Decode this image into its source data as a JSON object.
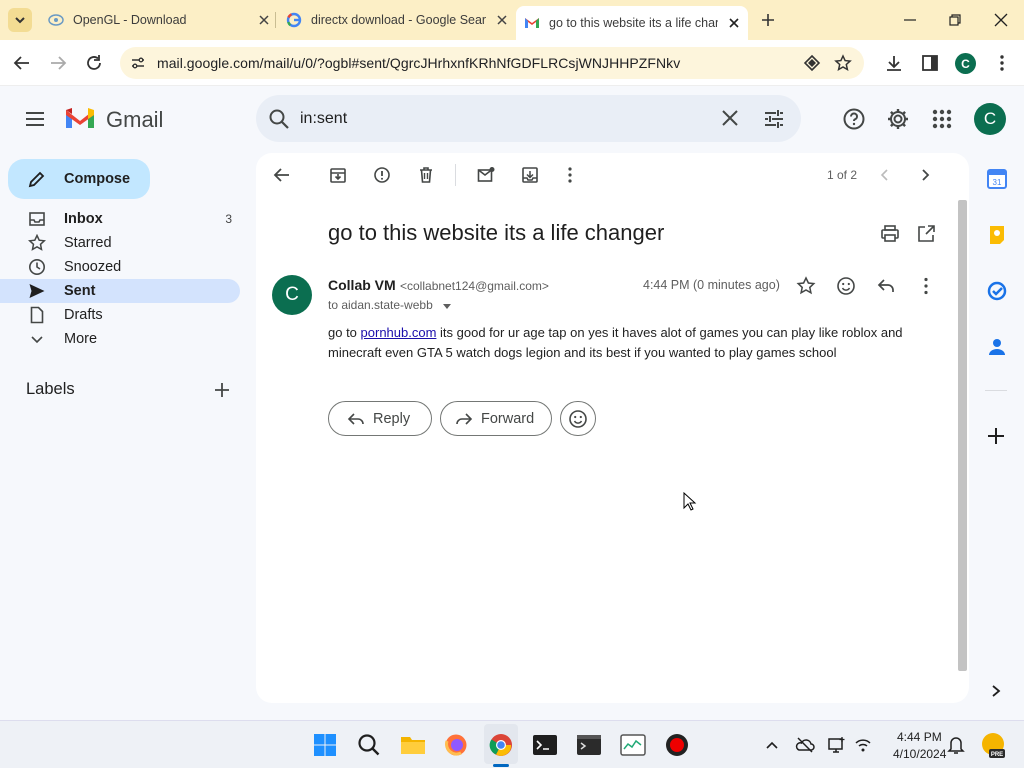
{
  "browser": {
    "tabs": [
      {
        "title": "OpenGL - Download",
        "active": false
      },
      {
        "title": "directx download - Google Sear",
        "active": false
      },
      {
        "title": "go to this website its a life chan",
        "active": true
      }
    ],
    "url": "mail.google.com/mail/u/0/?ogbl#sent/QgrcJHrhxnfKRhNfGDFLRCsjWNJHHPZFNkv",
    "profile_initial": "C"
  },
  "gmail": {
    "logo_text": "Gmail",
    "search_value": "in:sent",
    "account_initial": "C",
    "compose_label": "Compose",
    "nav": [
      {
        "label": "Inbox",
        "count": "3",
        "icon": "inbox-icon"
      },
      {
        "label": "Starred",
        "count": "",
        "icon": "star-icon"
      },
      {
        "label": "Snoozed",
        "count": "",
        "icon": "clock-icon"
      },
      {
        "label": "Sent",
        "count": "",
        "icon": "send-icon"
      },
      {
        "label": "Drafts",
        "count": "",
        "icon": "draft-icon"
      },
      {
        "label": "More",
        "count": "",
        "icon": "chevron-down-icon"
      }
    ],
    "labels_heading": "Labels",
    "pager": "1 of 2"
  },
  "email": {
    "subject": "go to this website its a life changer",
    "sender_initial": "C",
    "sender_name": "Collab VM",
    "sender_email": "<collabnet124@gmail.com>",
    "to": "to aidan.state-webb",
    "time": "4:44 PM (0 minutes ago)",
    "body_prefix": "go to ",
    "body_link": "pornhub.com",
    "body_line1_rest": " its good for ur age  tap on yes it haves alot of games you can play like roblox and",
    "body_line2": "minecraft even GTA 5 watch dogs legion and its best if you wanted to play games school",
    "reply_label": "Reply",
    "forward_label": "Forward"
  },
  "taskbar": {
    "time": "4:44 PM",
    "date": "4/10/2024"
  },
  "colors": {
    "tabstrip": "#fcefc6",
    "compose": "#c2e7ff",
    "sent_highlight": "#d3e3fd",
    "avatar": "#0b6e50",
    "link": "#1a0dab"
  }
}
